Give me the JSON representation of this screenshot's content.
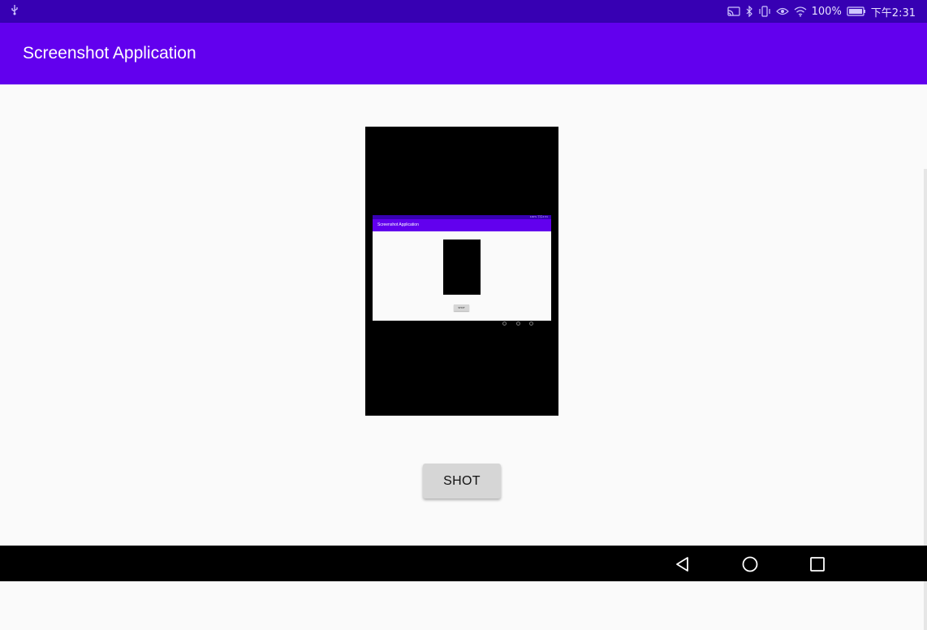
{
  "status_bar": {
    "usb_icon": "usb-icon",
    "battery_percent": "100%",
    "time": "下午2:31",
    "icons": [
      "cast-icon",
      "bluetooth-icon",
      "vibrate-icon",
      "eye-icon",
      "wifi-icon",
      "battery-icon"
    ]
  },
  "app_bar": {
    "title": "Screenshot Application"
  },
  "preview": {
    "mini_title": "Screenshot Application",
    "mini_status_text": "100% 下午2:31",
    "mini_button_label": "SHOT"
  },
  "main": {
    "shot_button_label": "SHOT"
  },
  "nav_bar": {
    "buttons": [
      "back-icon",
      "home-icon",
      "recents-icon"
    ]
  },
  "colors": {
    "status_bar": "#3700b3",
    "app_bar": "#6200ee",
    "background": "#fafafa",
    "button": "#d6d6d6"
  }
}
